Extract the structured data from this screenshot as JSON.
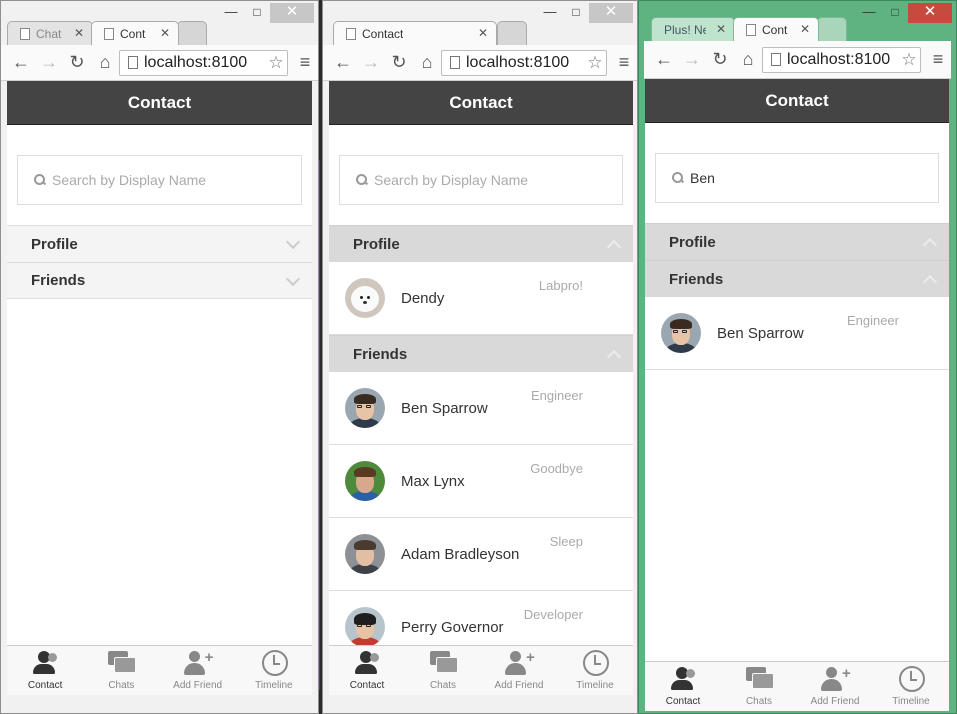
{
  "windows": [
    {
      "tabs": [
        {
          "title": "Chat",
          "active": false
        },
        {
          "title": "Cont",
          "active": true
        }
      ],
      "url": "localhost:8100",
      "header": "Contact",
      "search_placeholder": "Search by Display Name",
      "search_value": "",
      "groups": [
        {
          "label": "Profile",
          "expanded": false
        },
        {
          "label": "Friends",
          "expanded": false
        }
      ]
    },
    {
      "tabs": [
        {
          "title": "Contact",
          "active": true
        }
      ],
      "url": "localhost:8100",
      "header": "Contact",
      "search_placeholder": "Search by Display Name",
      "search_value": "",
      "profile_label": "Profile",
      "profile_items": [
        {
          "name": "Dendy",
          "status": "Labpro!",
          "avatar": "dog"
        }
      ],
      "friends_label": "Friends",
      "friends_items": [
        {
          "name": "Ben Sparrow",
          "status": "Engineer",
          "avatar": "ben"
        },
        {
          "name": "Max Lynx",
          "status": "Goodbye",
          "avatar": "max"
        },
        {
          "name": "Adam Bradleyson",
          "status": "Sleep",
          "avatar": "adam"
        },
        {
          "name": "Perry Governor",
          "status": "Developer",
          "avatar": "perry"
        }
      ]
    },
    {
      "tabs": [
        {
          "title": "Plus! Ne",
          "active": false
        },
        {
          "title": "Cont",
          "active": true
        }
      ],
      "url": "localhost:8100",
      "header": "Contact",
      "search_value": "Ben",
      "profile_label": "Profile",
      "friends_label": "Friends",
      "friends_items": [
        {
          "name": "Ben Sparrow",
          "status": "Engineer",
          "avatar": "ben"
        }
      ]
    }
  ],
  "tabbar": [
    {
      "label": "Contact",
      "icon": "contact-icon",
      "active": true
    },
    {
      "label": "Chats",
      "icon": "chat-icon",
      "active": false
    },
    {
      "label": "Add Friend",
      "icon": "add-friend-icon",
      "active": false
    },
    {
      "label": "Timeline",
      "icon": "clock-icon",
      "active": false
    }
  ],
  "colors": {
    "header": "#444444",
    "window3_frame": "#5fb381",
    "group_open": "#d9d9d9"
  }
}
